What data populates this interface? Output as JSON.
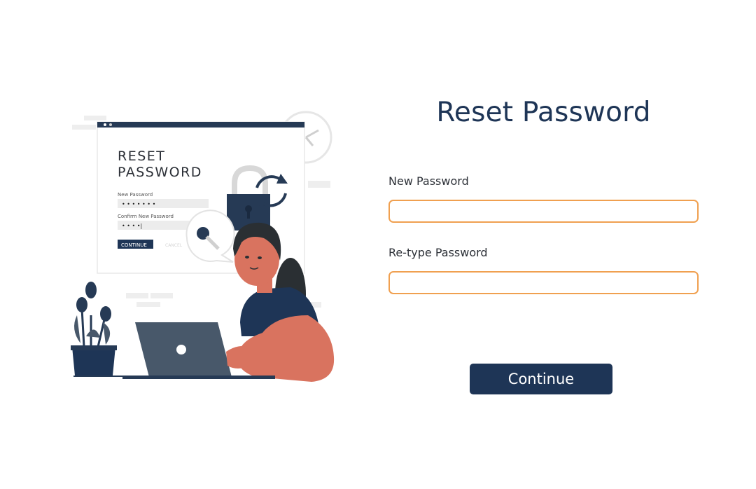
{
  "illustration": {
    "card_title_line1": "RESET",
    "card_title_line2": "PASSWORD",
    "card_field1_label": "New Password",
    "card_field1_value": "• • • • • • •",
    "card_field2_label": "Confirm New Password",
    "card_field2_value": "• • • •|",
    "card_button_label": "CONTINUE",
    "card_cancel_label": "CANCEL"
  },
  "form": {
    "title": "Reset Password",
    "new_password_label": "New Password",
    "new_password_value": "",
    "retype_password_label": "Re-type Password",
    "retype_password_value": "",
    "continue_label": "Continue"
  },
  "colors": {
    "brand_navy": "#1e3556",
    "input_border": "#f0a050",
    "skin": "#d9735f"
  }
}
